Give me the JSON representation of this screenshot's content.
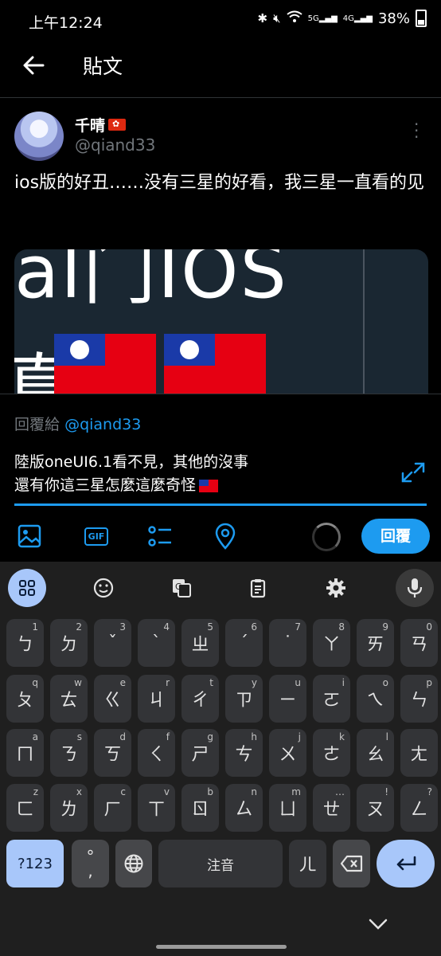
{
  "status": {
    "time": "上午12:24",
    "battery": "38%",
    "net5g": "5G",
    "net4g": "4G"
  },
  "header": {
    "title": "貼文"
  },
  "tweet": {
    "name": "千晴",
    "handle": "@qiand33",
    "text": "ios版的好丑……没有三星的好看，我三星一直看的见",
    "media_text_top": "al门IOS",
    "media_text_left": "真"
  },
  "reply": {
    "prefix": "回覆給",
    "to": "@qiand33",
    "line1": "陸版oneUI6.1看不見，其他的沒事",
    "line2": "還有你這三星怎麼這麼奇怪",
    "button": "回覆"
  },
  "toolbar": {
    "icons": [
      "image-icon",
      "gif-icon",
      "poll-icon",
      "location-icon"
    ],
    "gif": "GIF"
  },
  "keyboard": {
    "row1": [
      [
        "ㄅ",
        "1"
      ],
      [
        "ㄉ",
        "2"
      ],
      [
        "ˇ",
        "3"
      ],
      [
        "ˋ",
        "4"
      ],
      [
        "ㄓ",
        "5"
      ],
      [
        "ˊ",
        "6"
      ],
      [
        "˙",
        "7"
      ],
      [
        "ㄚ",
        "8"
      ],
      [
        "ㄞ",
        "9"
      ],
      [
        "ㄢ",
        "0"
      ]
    ],
    "row2": [
      [
        "ㄆ",
        "q"
      ],
      [
        "ㄊ",
        "w"
      ],
      [
        "ㄍ",
        "e"
      ],
      [
        "ㄐ",
        "r"
      ],
      [
        "ㄔ",
        "t"
      ],
      [
        "ㄗ",
        "y"
      ],
      [
        "ㄧ",
        "u"
      ],
      [
        "ㄛ",
        "i"
      ],
      [
        "ㄟ",
        "o"
      ],
      [
        "ㄣ",
        "p"
      ]
    ],
    "row3": [
      [
        "ㄇ",
        "a"
      ],
      [
        "ㄋ",
        "s"
      ],
      [
        "ㄎ",
        "d"
      ],
      [
        "ㄑ",
        "f"
      ],
      [
        "ㄕ",
        "g"
      ],
      [
        "ㄘ",
        "h"
      ],
      [
        "ㄨ",
        "j"
      ],
      [
        "ㄜ",
        "k"
      ],
      [
        "ㄠ",
        "l"
      ],
      [
        "ㄤ",
        ""
      ]
    ],
    "row4": [
      [
        "ㄈ",
        "z"
      ],
      [
        "ㄌ",
        "x"
      ],
      [
        "ㄏ",
        "c"
      ],
      [
        "ㄒ",
        "v"
      ],
      [
        "ㄖ",
        "b"
      ],
      [
        "ㄙ",
        "n"
      ],
      [
        "ㄩ",
        "m"
      ],
      [
        "ㄝ",
        "…"
      ],
      [
        "ㄡ",
        "!"
      ],
      [
        "ㄥ",
        "?"
      ]
    ],
    "sym": "?123",
    "punct": "°\n,",
    "space": "注音",
    "er": "ㄦ"
  }
}
